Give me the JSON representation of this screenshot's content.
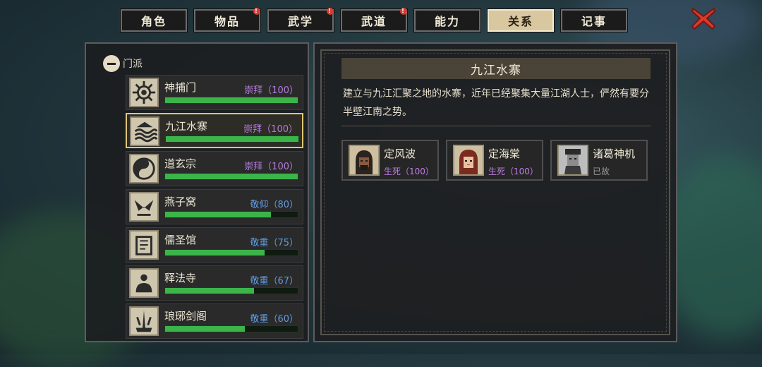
{
  "tabs": [
    {
      "label": "角色",
      "badge": false,
      "active": false
    },
    {
      "label": "物品",
      "badge": true,
      "active": false
    },
    {
      "label": "武学",
      "badge": true,
      "active": false
    },
    {
      "label": "武道",
      "badge": true,
      "active": false
    },
    {
      "label": "能力",
      "badge": false,
      "active": false
    },
    {
      "label": "关系",
      "badge": false,
      "active": true
    },
    {
      "label": "记事",
      "badge": false,
      "active": false
    }
  ],
  "close_icon": "close-icon",
  "section": {
    "label": "门派"
  },
  "factions": [
    {
      "name": "神捕门",
      "rep": "崇拜（100）",
      "tier": "purple",
      "progress": 1.0,
      "selected": false
    },
    {
      "name": "九江水寨",
      "rep": "崇拜（100）",
      "tier": "purple",
      "progress": 1.0,
      "selected": true
    },
    {
      "name": "道玄宗",
      "rep": "崇拜（100）",
      "tier": "purple",
      "progress": 1.0,
      "selected": false
    },
    {
      "name": "燕子窝",
      "rep": "敬仰（80）",
      "tier": "blue",
      "progress": 0.8,
      "selected": false
    },
    {
      "name": "儒圣馆",
      "rep": "敬重（75）",
      "tier": "blue",
      "progress": 0.75,
      "selected": false
    },
    {
      "name": "释法寺",
      "rep": "敬重（67）",
      "tier": "blue",
      "progress": 0.67,
      "selected": false
    },
    {
      "name": "琅琊剑阁",
      "rep": "敬重（60）",
      "tier": "blue",
      "progress": 0.6,
      "selected": false
    }
  ],
  "detail": {
    "title": "九江水寨",
    "description": "建立与九江汇聚之地的水寨，近年已经聚集大量江湖人士，俨然有要分半壁江南之势。",
    "npcs": [
      {
        "name": "定风波",
        "status": "生死（100）",
        "tier": "purple"
      },
      {
        "name": "定海棠",
        "status": "生死（100）",
        "tier": "purple"
      },
      {
        "name": "诸葛神机",
        "status": "已故",
        "tier": "grey"
      }
    ]
  },
  "colors": {
    "accent": "#e0c574",
    "bar": "#3bb54a",
    "rep_purple": "#b47ce0",
    "rep_blue": "#5f9be0"
  }
}
